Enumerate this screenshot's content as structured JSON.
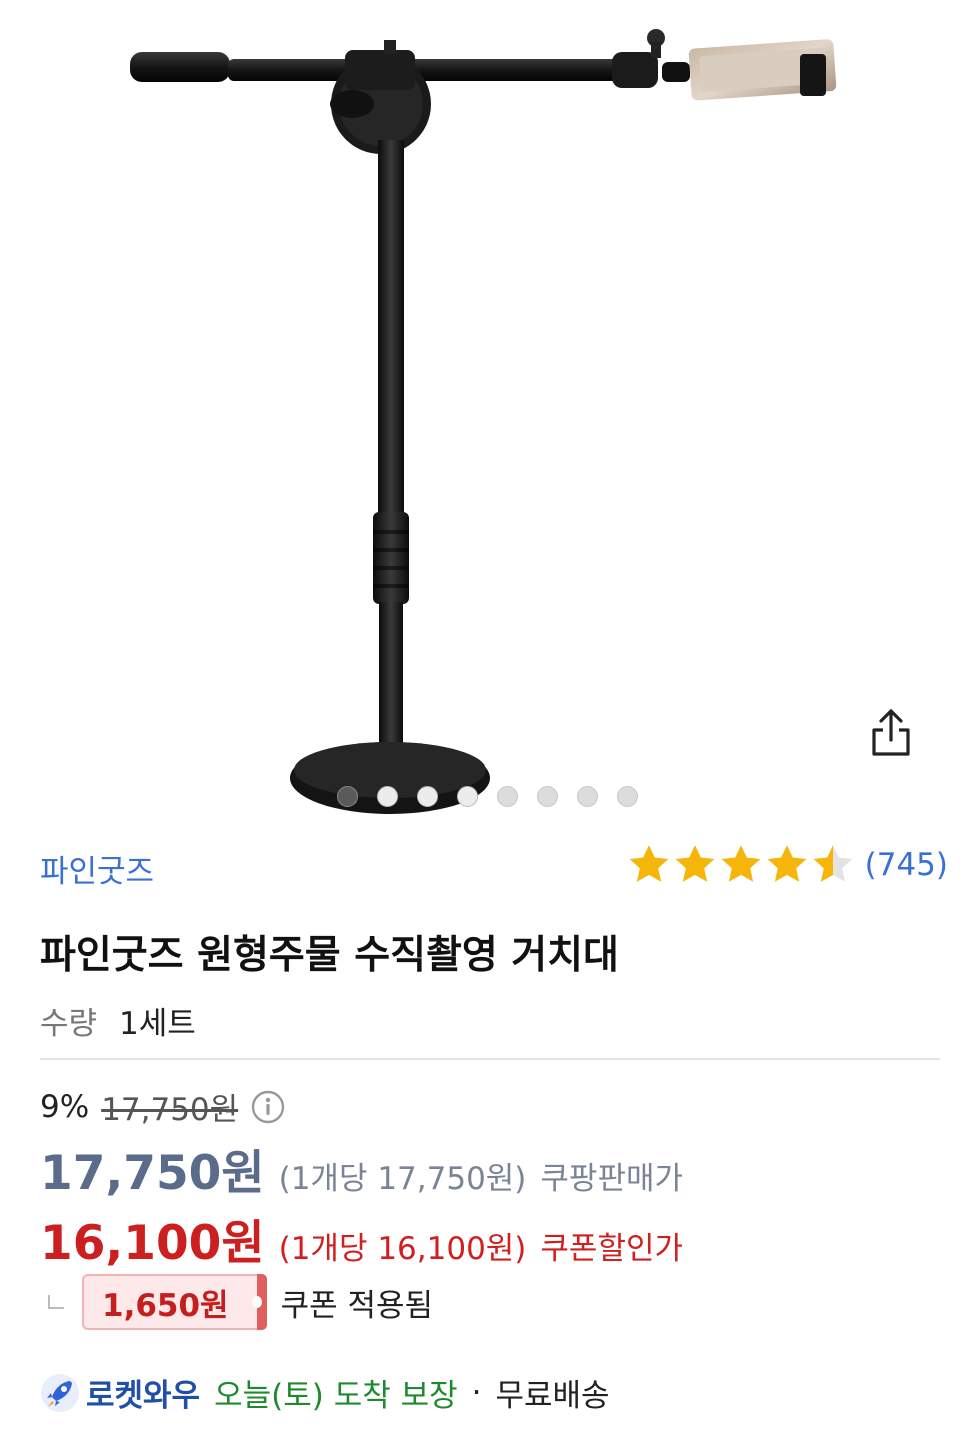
{
  "gallery": {
    "image_alt": "원형주물 수직촬영 거치대 제품 이미지",
    "share_icon": "share-icon",
    "dot_count": 8,
    "active_index": 0
  },
  "product": {
    "brand": "파인굿즈",
    "rating_value": 4.5,
    "rating_count": "(745)",
    "title": "파인굿즈 원형주물 수직촬영 거치대",
    "quantity_label": "수량",
    "quantity_value": "1세트"
  },
  "pricing": {
    "discount_percent": "9%",
    "original_price": "17,750원",
    "info_icon": "info-icon",
    "sale_price": "17,750원",
    "sale_unit": "(1개당 17,750원)",
    "sale_label": "쿠팡판매가",
    "coupon_price": "16,100원",
    "coupon_unit": "(1개당 16,100원)",
    "coupon_label": "쿠폰할인가",
    "coupon_amount": "1,650원",
    "coupon_applied": "쿠폰 적용됨"
  },
  "delivery": {
    "rocket_icon": "rocket-icon",
    "rocket_label": "로켓와우",
    "arrival": "오늘(토) 도착 보장",
    "separator": "·",
    "shipping": "무료배송"
  },
  "colors": {
    "brand_blue": "#3a6fd3",
    "star_yellow": "#f5b50a",
    "coupon_red": "#cc1f1f",
    "sale_gray": "#5b6b8a",
    "arrival_green": "#1e8a2e"
  }
}
